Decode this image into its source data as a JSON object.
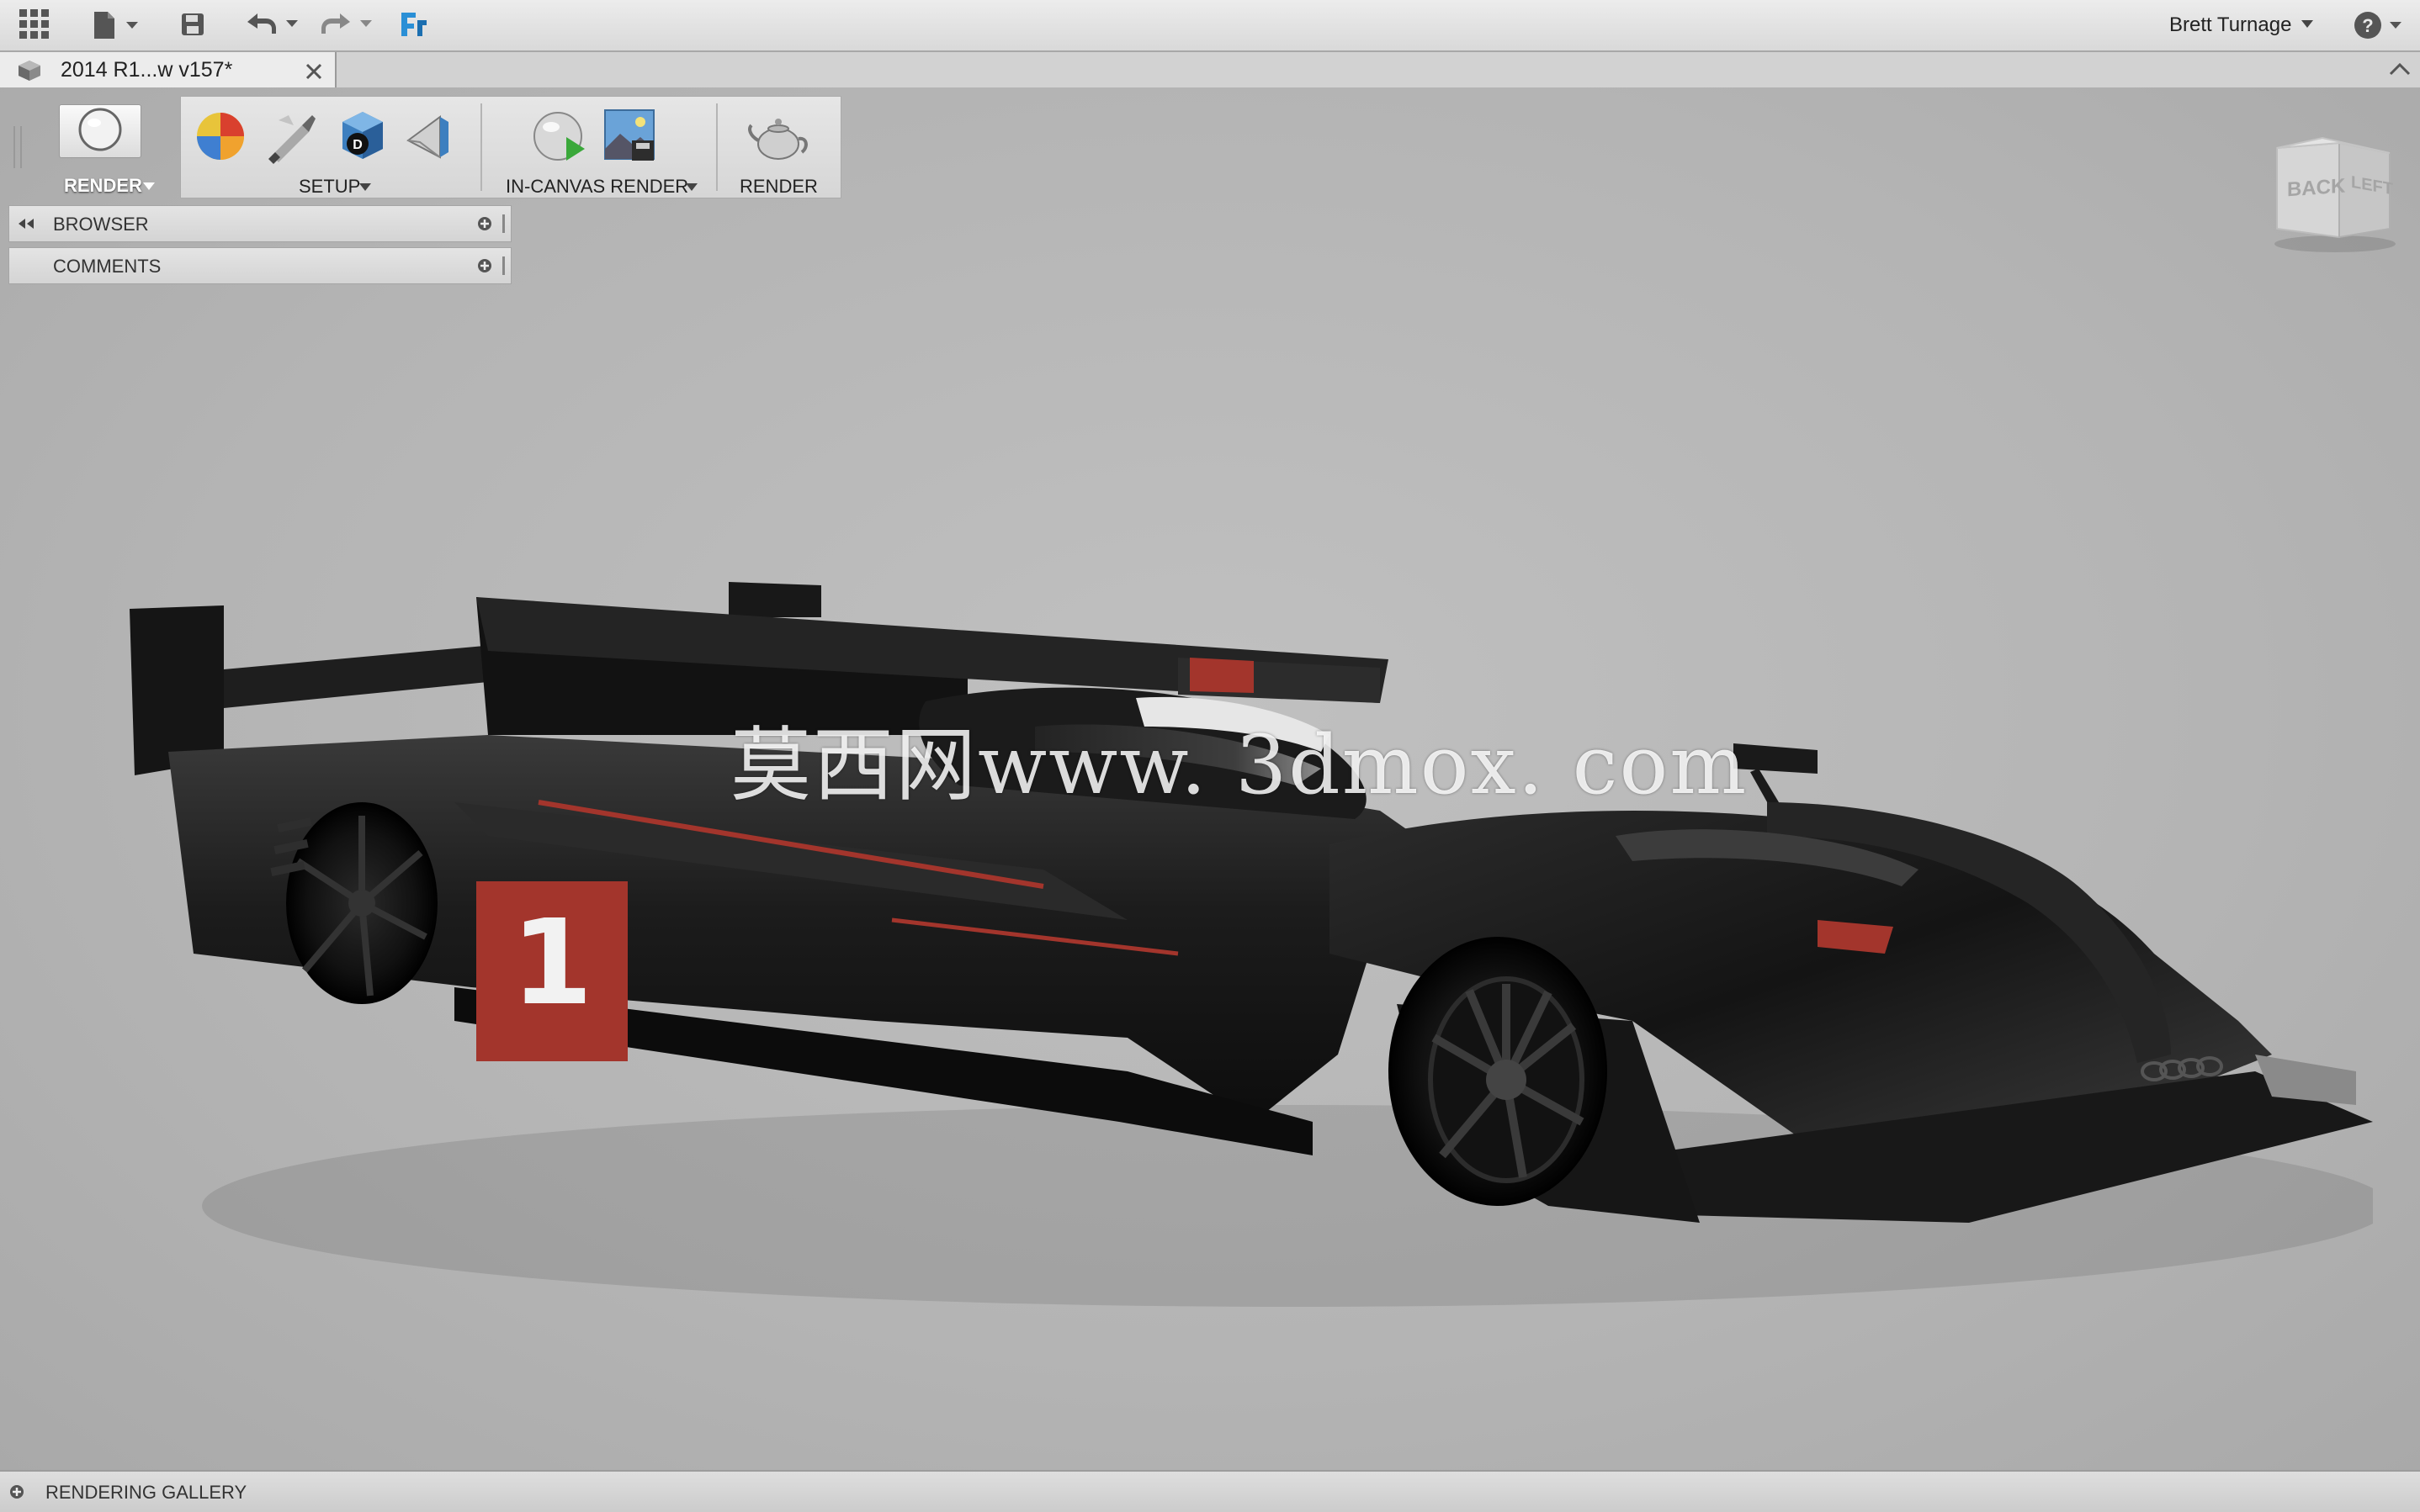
{
  "topbar": {
    "apps_icon": "grid-icon",
    "file_icon": "file-icon",
    "save_icon": "save-icon",
    "undo_icon": "undo-icon",
    "redo_icon": "redo-icon",
    "app_logo_icon": "fusion-logo-icon",
    "user_name": "Brett Turnage",
    "help_icon": "help-icon"
  },
  "tab": {
    "title": "2014 R1...w v157*",
    "close_icon": "close-icon"
  },
  "toolbar": {
    "workspace_label": "RENDER",
    "setup_label": "SETUP",
    "in_canvas_label": "IN-CANVAS RENDER",
    "render_label": "RENDER"
  },
  "panels": {
    "browser": "BROWSER",
    "comments": "COMMENTS"
  },
  "viewcube": {
    "back": "BACK",
    "left": "LEFT"
  },
  "car": {
    "number": "1"
  },
  "watermark": "莫西网www. 3dmox. com",
  "bottom": {
    "gallery_label": "RENDERING GALLERY"
  },
  "colors": {
    "accent_blue": "#2a8fd6",
    "livery_red": "#a3352c",
    "body_black": "#1c1c1c"
  }
}
